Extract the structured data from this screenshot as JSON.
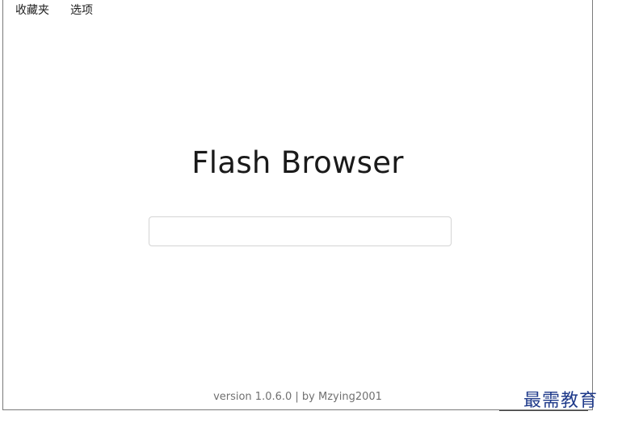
{
  "menubar": {
    "items": [
      {
        "label": "收藏夹"
      },
      {
        "label": "选项"
      }
    ]
  },
  "main": {
    "title": "Flash Browser",
    "address_input": {
      "value": "",
      "placeholder": ""
    }
  },
  "footer": {
    "text": "version 1.0.6.0 | by Mzying2001"
  },
  "watermark": {
    "text": "最需教育"
  }
}
